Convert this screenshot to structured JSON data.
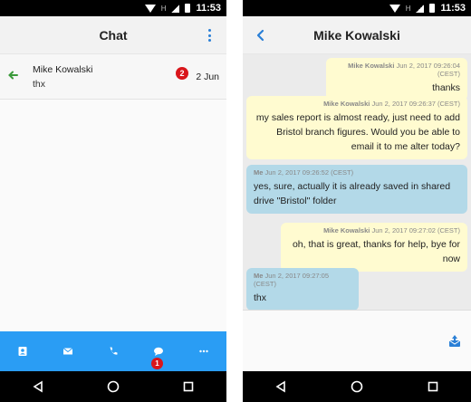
{
  "status": {
    "time": "11:53",
    "network_label": "H"
  },
  "list_screen": {
    "title": "Chat",
    "conversations": [
      {
        "name": "Mike Kowalski",
        "preview": "thx",
        "unread": "2",
        "date": "2 Jun"
      }
    ],
    "nav": {
      "tabs": [
        "contacts-icon",
        "mail-icon",
        "phone-icon",
        "chat-icon",
        "more-icon"
      ],
      "chat_badge": "1"
    }
  },
  "chat_screen": {
    "title": "Mike Kowalski",
    "messages": [
      {
        "dir": "in",
        "sender": "Mike Kowalski",
        "timestamp": "Jun 2, 2017 09:26:04 (CEST)",
        "text": "thanks"
      },
      {
        "dir": "in",
        "sender": "Mike Kowalski",
        "timestamp": "Jun 2, 2017 09:26:37 (CEST)",
        "text": "my sales report is almost ready, just need to add Bristol branch figures. Would you be able to email it to me alter today?"
      },
      {
        "dir": "out",
        "sender": "Me",
        "timestamp": "Jun 2, 2017 09:26:52 (CEST)",
        "text": "yes, sure, actually it is already saved in shared drive \"Bristol\" folder"
      },
      {
        "dir": "in",
        "sender": "Mike Kowalski",
        "timestamp": "Jun 2, 2017 09:27:02 (CEST)",
        "text": "oh, that is great, thanks for help, bye for now"
      },
      {
        "dir": "out",
        "sender": "Me",
        "timestamp": "Jun 2, 2017 09:27:05 (CEST)",
        "text": "thx"
      }
    ]
  },
  "colors": {
    "accent": "#2a9df4",
    "badge": "#d9161b",
    "incoming": "#fffbd0",
    "outgoing": "#b3d9e8"
  }
}
